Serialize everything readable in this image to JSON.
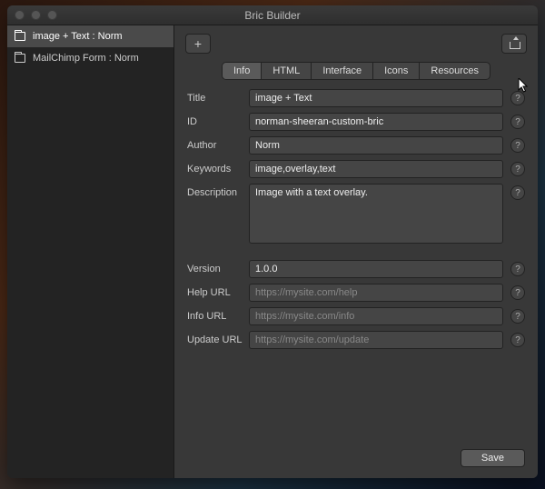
{
  "window": {
    "title": "Bric Builder"
  },
  "sidebar": {
    "items": [
      {
        "label": "image + Text : Norm"
      },
      {
        "label": "MailChimp Form : Norm"
      }
    ]
  },
  "tabs": {
    "items": [
      "Info",
      "HTML",
      "Interface",
      "Icons",
      "Resources"
    ],
    "active": "Info"
  },
  "form": {
    "title": {
      "label": "Title",
      "value": "image + Text"
    },
    "id": {
      "label": "ID",
      "value": "norman-sheeran-custom-bric"
    },
    "author": {
      "label": "Author",
      "value": "Norm"
    },
    "keywords": {
      "label": "Keywords",
      "value": "image,overlay,text"
    },
    "description": {
      "label": "Description",
      "value": "Image with a text overlay."
    },
    "version": {
      "label": "Version",
      "value": "1.0.0"
    },
    "help_url": {
      "label": "Help URL",
      "placeholder": "https://mysite.com/help"
    },
    "info_url": {
      "label": "Info URL",
      "placeholder": "https://mysite.com/info"
    },
    "update_url": {
      "label": "Update URL",
      "placeholder": "https://mysite.com/update"
    }
  },
  "buttons": {
    "save": "Save"
  }
}
